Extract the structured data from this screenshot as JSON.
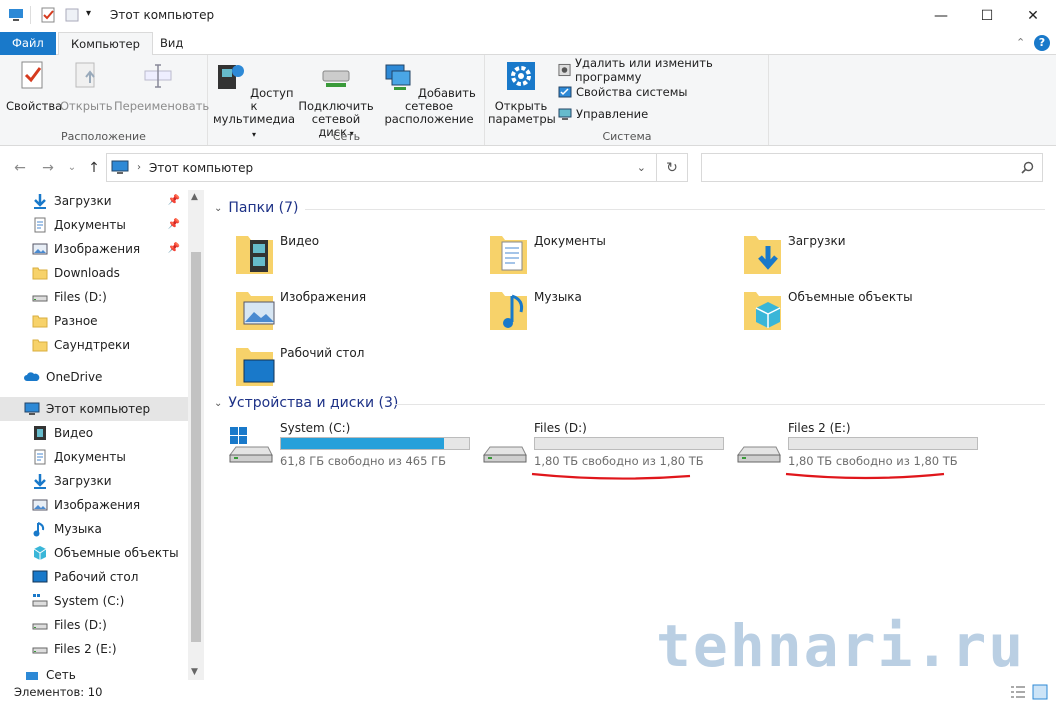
{
  "window": {
    "title": "Этот компьютер",
    "minimize": "—",
    "maximize": "☐",
    "close": "✕"
  },
  "tabs": [
    {
      "label": "Файл"
    },
    {
      "label": "Компьютер"
    },
    {
      "label": "Вид"
    }
  ],
  "ribbon": {
    "location": {
      "label": "Расположение",
      "buttons": [
        {
          "label": "Свойства"
        },
        {
          "label": "Открыть"
        },
        {
          "label": "Переименовать"
        }
      ]
    },
    "network": {
      "label": "Сеть",
      "buttons": [
        {
          "line1": "Доступ к",
          "line2": "мультимедиа"
        },
        {
          "line1": "Подключить",
          "line2": "сетевой диск"
        },
        {
          "line1": "Добавить сетевое",
          "line2": "расположение"
        }
      ]
    },
    "system": {
      "label": "Система",
      "open_line1": "Открыть",
      "open_line2": "параметры",
      "small": [
        {
          "label": "Удалить или изменить программу"
        },
        {
          "label": "Свойства системы"
        },
        {
          "label": "Управление"
        }
      ]
    }
  },
  "address": {
    "path": "Этот компьютер",
    "refresh": "↻",
    "back": "←",
    "forward": "→",
    "up": "↑",
    "recent": "⌄"
  },
  "sidebar": {
    "quick": [
      {
        "label": "Загрузки",
        "pinned": true
      },
      {
        "label": "Документы",
        "pinned": true
      },
      {
        "label": "Изображения",
        "pinned": true
      },
      {
        "label": "Downloads"
      },
      {
        "label": "Files (D:)"
      },
      {
        "label": "Разное"
      },
      {
        "label": "Саундтреки"
      }
    ],
    "onedrive": "OneDrive",
    "this_pc": "Этот компьютер",
    "pc_items": [
      {
        "label": "Видео"
      },
      {
        "label": "Документы"
      },
      {
        "label": "Загрузки"
      },
      {
        "label": "Изображения"
      },
      {
        "label": "Музыка"
      },
      {
        "label": "Объемные объекты"
      },
      {
        "label": "Рабочий стол"
      },
      {
        "label": "System (C:)"
      },
      {
        "label": "Files (D:)"
      },
      {
        "label": "Files 2 (E:)"
      }
    ],
    "network": "Сеть"
  },
  "folders_section": {
    "title": "Папки (7)"
  },
  "folders": [
    {
      "label": "Видео"
    },
    {
      "label": "Документы"
    },
    {
      "label": "Загрузки"
    },
    {
      "label": "Изображения"
    },
    {
      "label": "Музыка"
    },
    {
      "label": "Объемные объекты"
    },
    {
      "label": "Рабочий стол"
    }
  ],
  "drives_section": {
    "title": "Устройства и диски (3)"
  },
  "drives": [
    {
      "name": "System (C:)",
      "free": "61,8 ГБ свободно из 465 ГБ",
      "used_fraction": 0.867
    },
    {
      "name": "Files (D:)",
      "free": "1,80 ТБ свободно из 1,80 ТБ",
      "used_fraction": 0.0
    },
    {
      "name": "Files 2 (E:)",
      "free": "1,80 ТБ свободно из 1,80 ТБ",
      "used_fraction": 0.0
    }
  ],
  "status": {
    "items": "Элементов: 10"
  },
  "watermark": "tehnari.ru",
  "colors": {
    "accent": "#1979ca",
    "drive_bar": "#26a0da",
    "annotation": "#e0161b"
  }
}
